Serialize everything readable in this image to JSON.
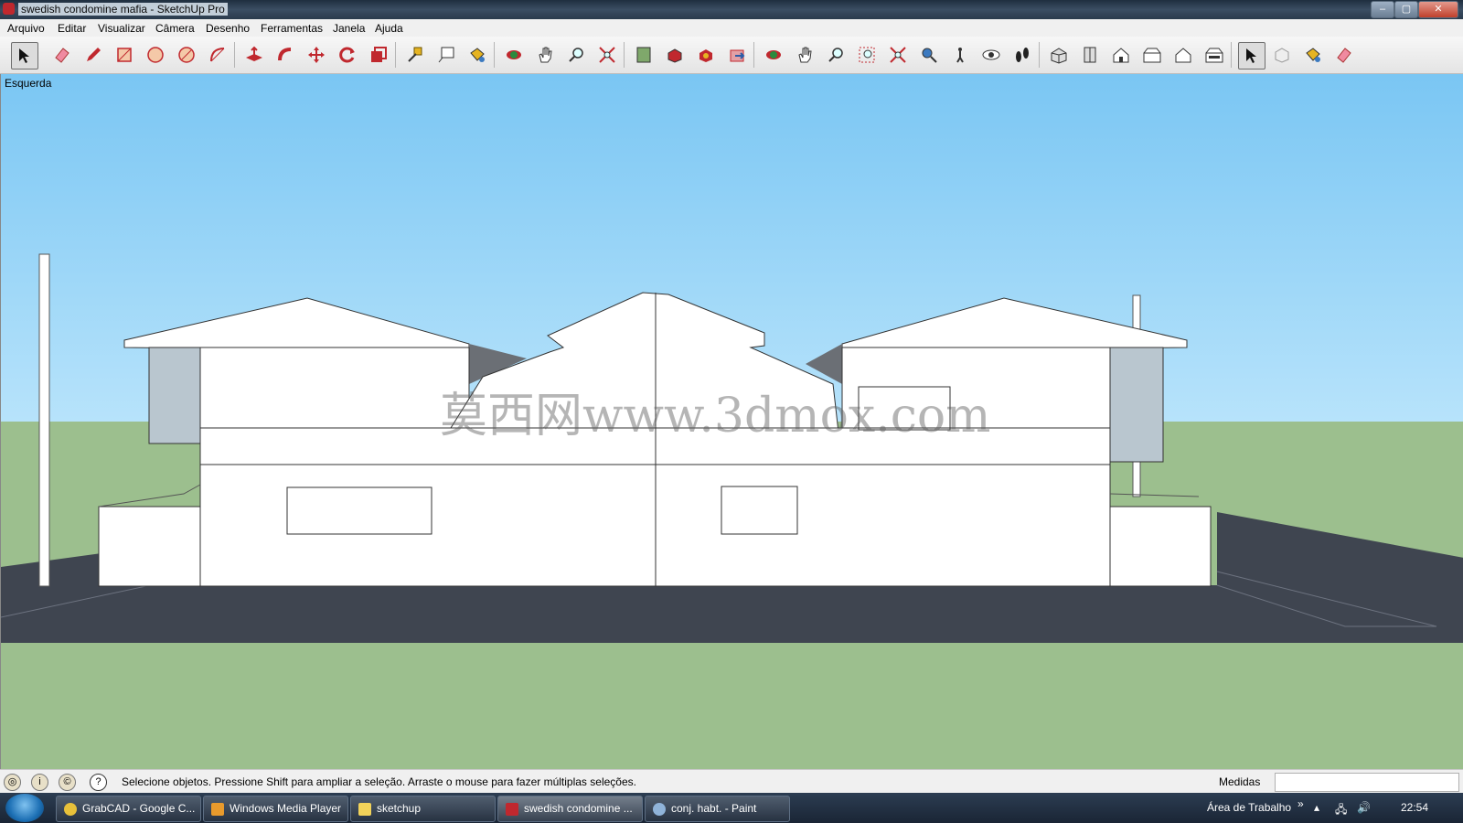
{
  "window": {
    "title": "swedish condomine mafia - SketchUp Pro",
    "minimize": "–",
    "maximize": "▢",
    "close": "✕"
  },
  "menu": [
    "Arquivo",
    "Editar",
    "Visualizar",
    "Câmera",
    "Desenho",
    "Ferramentas",
    "Janela",
    "Ajuda"
  ],
  "toolbar": {
    "tools": [
      "select",
      "eraser",
      "pencil",
      "rectangle",
      "circle",
      "polygon",
      "arc",
      "push-pull",
      "follow-me",
      "move",
      "rotate",
      "scale",
      "tape-measure",
      "text",
      "paint-bucket",
      "orbit",
      "pan",
      "zoom",
      "zoom-extents",
      "component",
      "google-earth",
      "add-location",
      "3d-warehouse",
      "orbit-2",
      "pan-2",
      "zoom-2",
      "zoom-window",
      "zoom-extents-2",
      "position-camera",
      "walk",
      "look-around",
      "footprints",
      "iso-view",
      "top-view",
      "front-view",
      "right-view",
      "back-view",
      "left-view",
      "select-2",
      "shaded",
      "paint-2",
      "eraser-2"
    ]
  },
  "scene": {
    "view_label": "Esquerda",
    "watermark": "莫西网www.3dmox.com",
    "colors": {
      "sky": "#7ac6f3",
      "ground": "#9cbf8e",
      "road": "#3f4550",
      "building": "#ffffff"
    }
  },
  "status": {
    "message": "Selecione objetos. Pressione Shift para ampliar a seleção. Arraste o mouse para fazer múltiplas seleções.",
    "measure_label": "Medidas",
    "measure_value": ""
  },
  "taskbar": {
    "items": [
      {
        "label": "GrabCAD - Google C...",
        "active": false
      },
      {
        "label": "Windows Media Player",
        "active": false
      },
      {
        "label": "sketchup",
        "active": false
      },
      {
        "label": "swedish condomine ...",
        "active": true
      },
      {
        "label": "conj. habt. - Paint",
        "active": false
      }
    ],
    "desktop_label": "Área de Trabalho",
    "chevron": "»",
    "clock": "22:54"
  }
}
